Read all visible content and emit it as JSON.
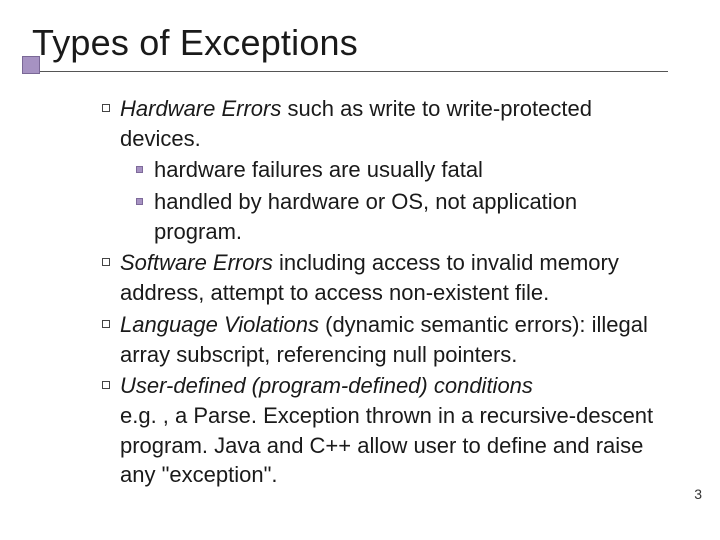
{
  "slide": {
    "title": "Types of Exceptions",
    "pageNumber": "3",
    "items": [
      {
        "emph": "Hardware Errors",
        "rest": " such as write to write-protected devices.",
        "sub": [
          "hardware failures are usually fatal",
          "handled by hardware or OS, not application program."
        ]
      },
      {
        "emph": "Software Errors",
        "rest": " including access to invalid memory address, attempt to access non-existent file."
      },
      {
        "emph": "Language Violations",
        "rest": " (dynamic semantic errors): illegal array subscript, referencing null pointers."
      },
      {
        "emph": "User-defined (program-defined) conditions",
        "rest": "",
        "tail": "e.g. , a Parse. Exception thrown in a recursive-descent program.  Java and C++ allow user to define and raise any \"exception\"."
      }
    ]
  }
}
